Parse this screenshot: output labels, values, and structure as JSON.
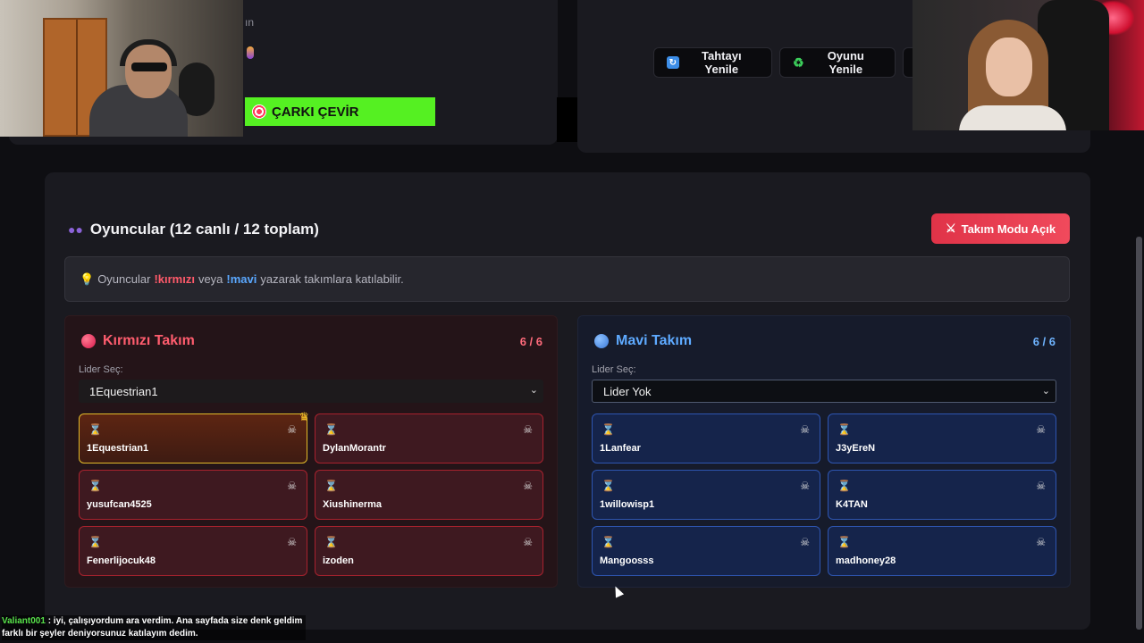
{
  "top": {
    "partial_text": "ın",
    "spin_button_label": "ÇARKI ÇEVİR",
    "refresh_board_label": "Tahtayı Yenile",
    "refresh_game_label": "Oyunu Yenile"
  },
  "players": {
    "title": "Oyuncular (12 canlı / 12 toplam)",
    "team_mode_label": "Takım Modu Açık",
    "info": {
      "prefix": "Oyuncular",
      "cmd_red": "!kırmızı",
      "middle": "veya",
      "cmd_blue": "!mavi",
      "suffix": "yazarak takımlara katılabilir."
    }
  },
  "teams": {
    "red": {
      "name": "Kırmızı Takım",
      "count": "6 / 6",
      "leader_label": "Lider Seç:",
      "leader_value": "1Equestrian1",
      "players": [
        "1Equestrian1",
        "DylanMorantr",
        "yusufcan4525",
        "Xiushinerma",
        "Fenerlijocuk48",
        "izoden"
      ]
    },
    "blue": {
      "name": "Mavi Takım",
      "count": "6 / 6",
      "leader_label": "Lider Seç:",
      "leader_value": "Lider Yok",
      "players": [
        "1Lanfear",
        "J3yEreN",
        "1willowisp1",
        "K4TAN",
        "Mangoosss",
        "madhoney28"
      ]
    }
  },
  "chat": {
    "user": "Valiant001",
    "message": ": iyi, çalışıyordum ara verdim. Ana sayfada size denk geldim farklı bir şeyler deniyorsunuz katılayım dedim."
  },
  "colors": {
    "red_team": "#ff5d6e",
    "blue_team": "#5eaaff",
    "spin_button": "#55f022",
    "team_mode_button": "#e03348",
    "leader_border": "#e2ba2a"
  }
}
